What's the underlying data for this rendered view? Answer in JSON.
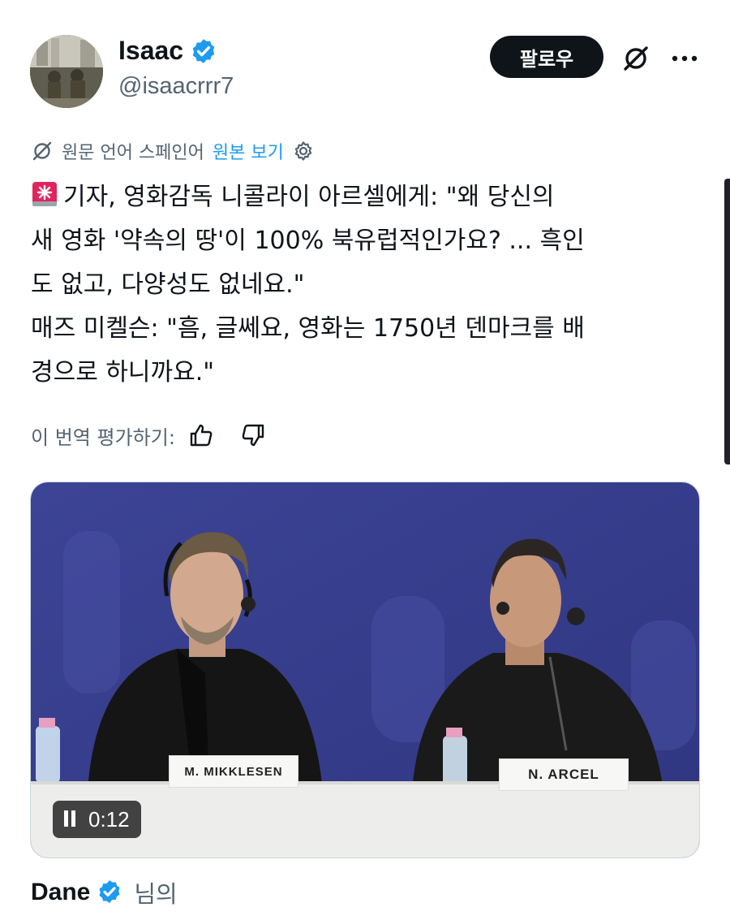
{
  "author": {
    "display_name": "Isaac",
    "handle": "@isaacrrr7",
    "verified": true
  },
  "header": {
    "follow_label": "팔로우",
    "grok_icon": "grok-slash-icon",
    "more_icon": "more-icon",
    "more_label": "···"
  },
  "translation": {
    "source_label": "원문 언어 스페인어",
    "show_original_label": "원본 보기",
    "settings_icon": "gear-icon"
  },
  "tweet": {
    "emoji": "rotating-light-emoji",
    "text": "기자, 영화감독 니콜라이 아르셀에게: \"왜 당신의\n새 영화 '약속의 땅'이 100% 북유럽적인가요? ... 흑인\n도 없고, 다양성도 없네요.\"\n매즈 미켈슨: \"흠, 글쎄요, 영화는 1750년 덴마크를 배\n경으로 하니까요.\""
  },
  "rating": {
    "label": "이 번역 평가하기:",
    "like_icon": "thumbs-up-icon",
    "dislike_icon": "thumbs-down-icon"
  },
  "media": {
    "type": "video",
    "timer": "0:12",
    "nameplate_left": "M. MIKKLESEN",
    "nameplate_right": "N. ARCEL"
  },
  "footer": {
    "display_name": "Dane",
    "verified": true,
    "suffix": "님의"
  },
  "colors": {
    "accent": "#1d9bf0",
    "text_primary": "#0f1419",
    "text_secondary": "#536471",
    "backdrop": "#3a3f8c"
  }
}
